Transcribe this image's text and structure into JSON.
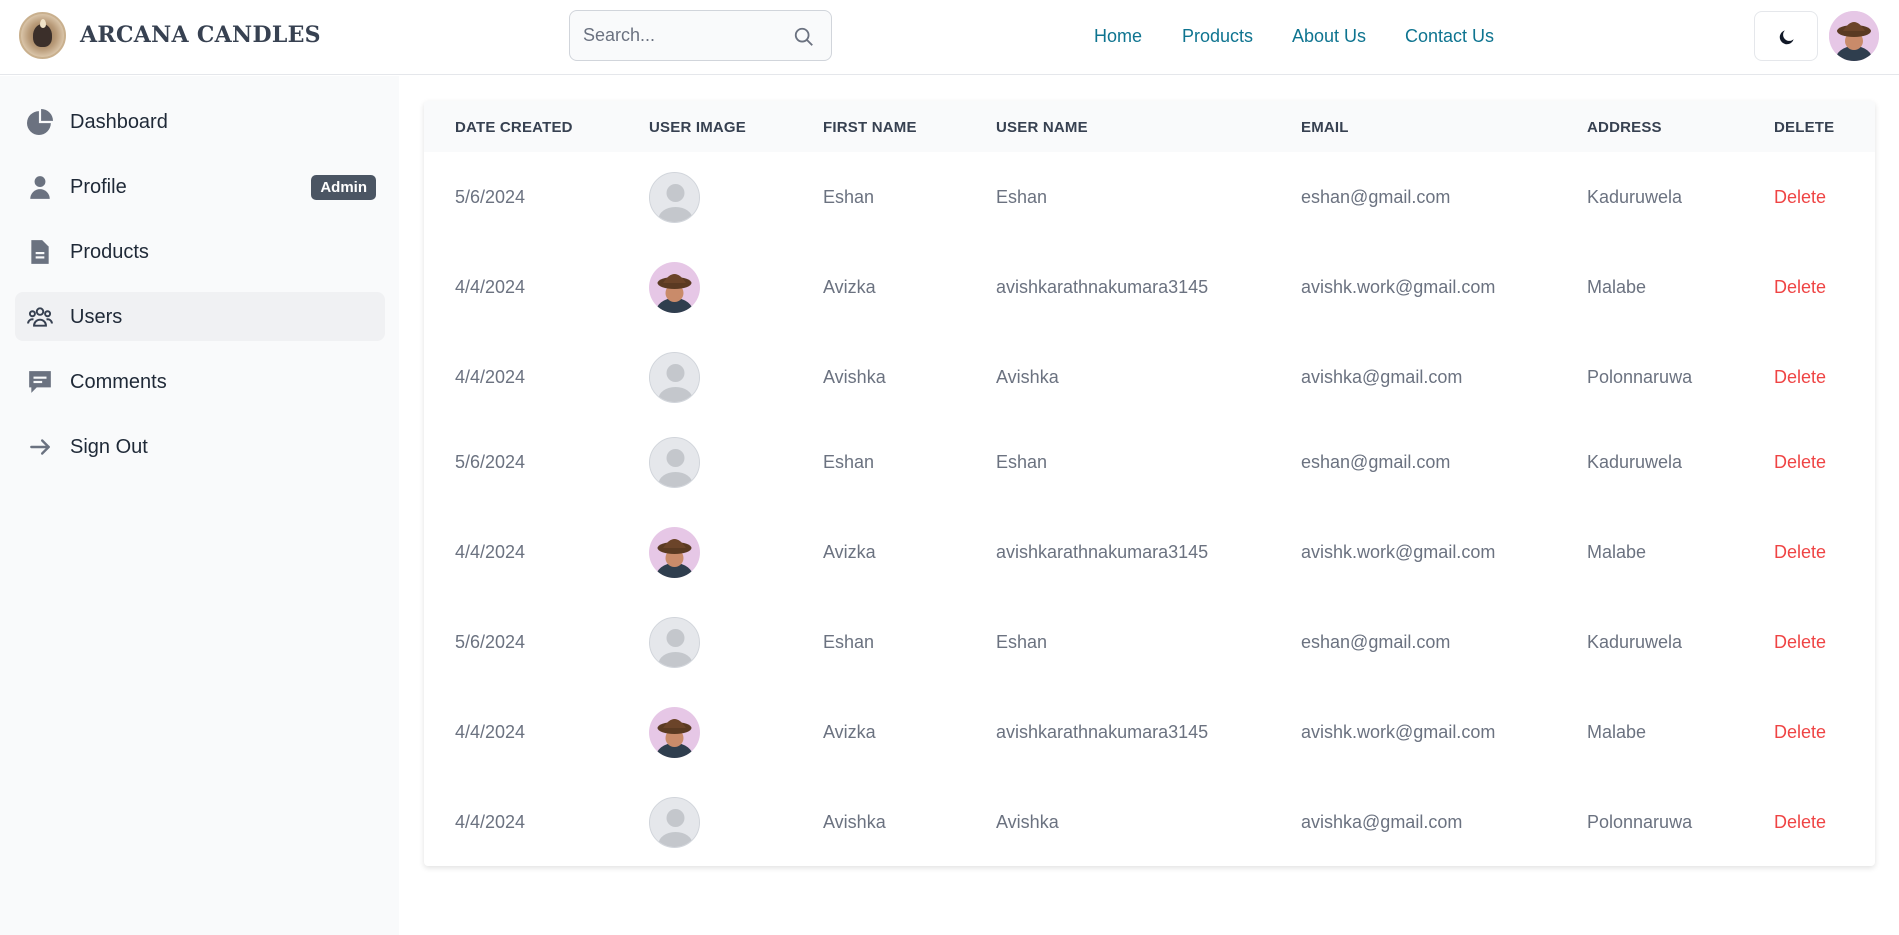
{
  "header": {
    "brand": "ARCANA CANDLES",
    "search_placeholder": "Search...",
    "nav": [
      "Home",
      "Products",
      "About Us",
      "Contact Us"
    ]
  },
  "sidebar": {
    "items": [
      {
        "label": "Dashboard",
        "icon": "pie-chart-icon"
      },
      {
        "label": "Profile",
        "icon": "user-icon",
        "badge": "Admin"
      },
      {
        "label": "Products",
        "icon": "document-icon"
      },
      {
        "label": "Users",
        "icon": "users-group-icon",
        "active": true
      },
      {
        "label": "Comments",
        "icon": "chat-icon"
      },
      {
        "label": "Sign Out",
        "icon": "arrow-right-icon"
      }
    ]
  },
  "table": {
    "headers": [
      "DATE CREATED",
      "USER IMAGE",
      "FIRST NAME",
      "USER NAME",
      "EMAIL",
      "ADDRESS",
      "DELETE"
    ],
    "rows": [
      {
        "date": "5/6/2024",
        "image": "default-avatar",
        "first": "Eshan",
        "user": "Eshan",
        "email": "eshan@gmail.com",
        "address": "Kaduruwela",
        "action": "Delete"
      },
      {
        "date": "4/4/2024",
        "image": "hat-avatar",
        "first": "Avizka",
        "user": "avishkarathnakumara3145",
        "email": "avishk.work@gmail.com",
        "address": "Malabe",
        "action": "Delete"
      },
      {
        "date": "4/4/2024",
        "image": "default-avatar",
        "first": "Avishka",
        "user": "Avishka",
        "email": "avishka@gmail.com",
        "address": "Polonnaruwa",
        "action": "Delete"
      },
      {
        "date": "5/6/2024",
        "image": "default-avatar",
        "first": "Eshan",
        "user": "Eshan",
        "email": "eshan@gmail.com",
        "address": "Kaduruwela",
        "action": "Delete"
      },
      {
        "date": "4/4/2024",
        "image": "hat-avatar",
        "first": "Avizka",
        "user": "avishkarathnakumara3145",
        "email": "avishk.work@gmail.com",
        "address": "Malabe",
        "action": "Delete"
      },
      {
        "date": "5/6/2024",
        "image": "default-avatar",
        "first": "Eshan",
        "user": "Eshan",
        "email": "eshan@gmail.com",
        "address": "Kaduruwela",
        "action": "Delete"
      },
      {
        "date": "4/4/2024",
        "image": "hat-avatar",
        "first": "Avizka",
        "user": "avishkarathnakumara3145",
        "email": "avishk.work@gmail.com",
        "address": "Malabe",
        "action": "Delete"
      },
      {
        "date": "4/4/2024",
        "image": "default-avatar",
        "first": "Avishka",
        "user": "Avishka",
        "email": "avishka@gmail.com",
        "address": "Polonnaruwa",
        "action": "Delete"
      }
    ]
  },
  "colors": {
    "nav_link": "#0e7490",
    "delete": "#ef4444",
    "badge_bg": "#4b5563"
  }
}
